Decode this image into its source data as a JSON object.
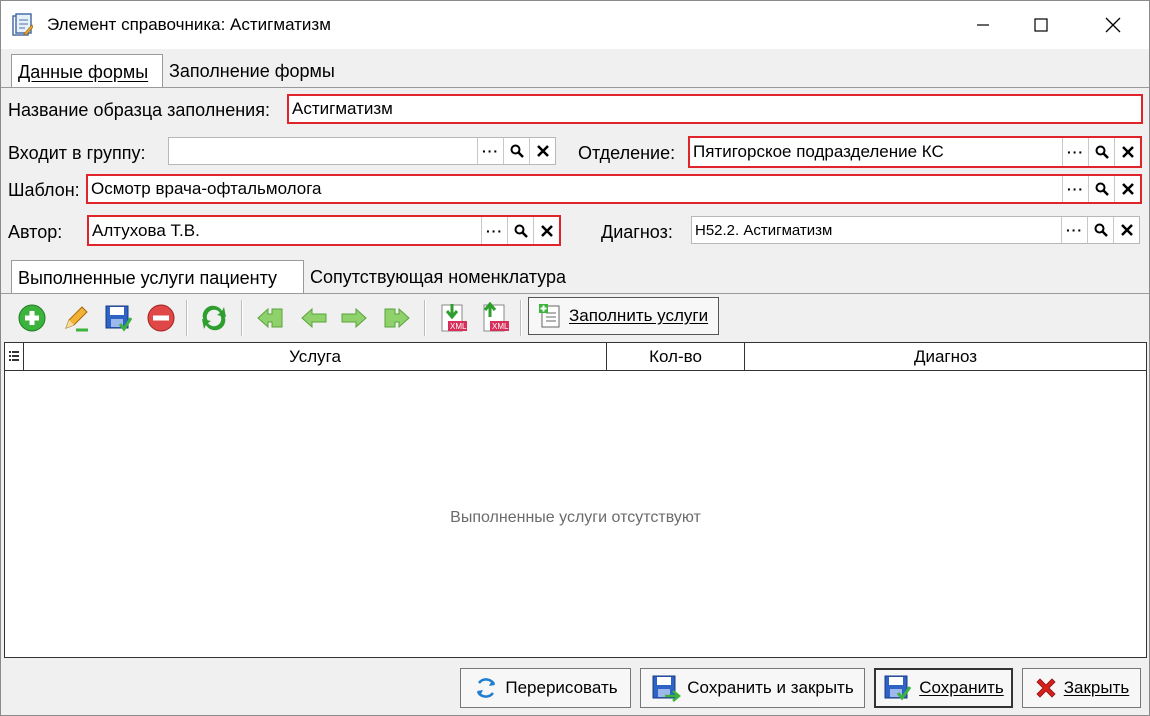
{
  "window": {
    "title": "Элемент справочника: Астигматизм",
    "controls": [
      "minimize-icon",
      "maximize-icon",
      "close-icon"
    ]
  },
  "tabs": [
    {
      "label": "Данные формы",
      "active": true
    },
    {
      "label": "Заполнение формы",
      "active": false
    }
  ],
  "form": {
    "name_label": "Название образца заполнения:",
    "name_value": "Астигматизм",
    "group_label": "Входит в группу:",
    "group_value": "",
    "department_label": "Отделение:",
    "department_value": "Пятигорское подразделение КС",
    "template_label": "Шаблон:",
    "template_value": "Осмотр врача-офтальмолога",
    "author_label": "Автор:",
    "author_value": "Алтухова Т.В.",
    "diagnosis_label": "Диагноз:",
    "diagnosis_value": "H52.2. Астигматизм",
    "field_buttons": [
      "ellipsis-icon",
      "search-icon",
      "clear-icon"
    ]
  },
  "subtabs": [
    {
      "label": "Выполненные услуги пациенту",
      "active": true
    },
    {
      "label": "Сопутствующая номенклатура",
      "active": false
    }
  ],
  "toolbar": {
    "icons": [
      "add-icon",
      "edit-icon",
      "save-icon",
      "delete-icon",
      "refresh-icon",
      "first-icon",
      "prev-icon",
      "next-icon",
      "last-icon",
      "import-xml-icon",
      "export-xml-icon"
    ],
    "fill_label": "Заполнить услуги"
  },
  "grid": {
    "columns": [
      "Услуга",
      "Кол-во",
      "Диагноз"
    ],
    "rows": [],
    "empty_text": "Выполненные услуги отсутствуют"
  },
  "buttons": {
    "redraw": "Перерисовать",
    "save_close": "Сохранить и закрыть",
    "save": "Сохранить",
    "close": "Закрыть"
  },
  "colors": {
    "required_border": "#e0242c",
    "add_green": "#3cb33c",
    "delete_red": "#e04848",
    "nav_green": "#8fd16b",
    "close_red": "#d6201c"
  }
}
